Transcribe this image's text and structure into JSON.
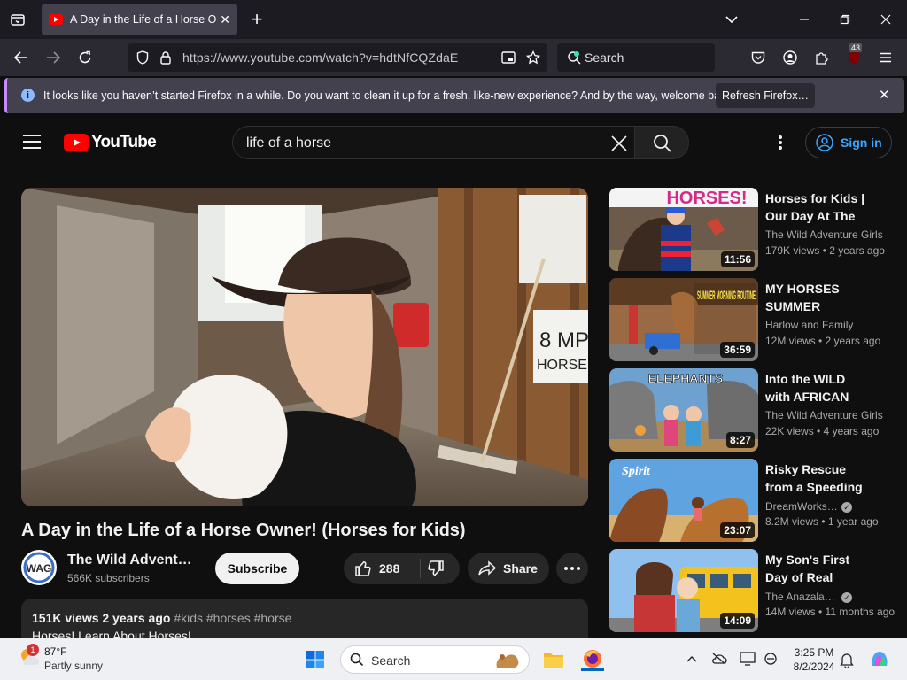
{
  "browser": {
    "tab_title": "A Day in the Life of a Horse Owner! (Horses for Kids) - YouTube",
    "url": "https://www.youtube.com/watch?v=hdtNfCQZdaE",
    "search_placeholder": "Search",
    "extension_badge": "43"
  },
  "notification": {
    "message": "It looks like you haven’t started Firefox in a while. Do you want to clean it up for a fresh, like-new experience? And by the way, welcome back!",
    "refresh_label": "Refresh Firefox…"
  },
  "youtube": {
    "logo_text": "YouTube",
    "search_query": "life of a horse",
    "sign_in_label": "Sign in"
  },
  "video": {
    "title": "A Day in the Life of a Horse Owner! (Horses for Kids)",
    "channel_name": "The Wild Adventure Girls",
    "subscribers": "566K subscribers",
    "avatar_text": "WAG",
    "subscribe_label": "Subscribe",
    "likes": "288",
    "share_label": "Share",
    "views_date": "151K views  2 years ago",
    "hashtags": "#kids #horses #horse",
    "description_line": "Horses! Learn About Horses!"
  },
  "recommendations": [
    {
      "title": "Horses for Kids | Our Day At The Farm",
      "channel": "The Wild Adventure Girls",
      "verified": false,
      "stats": "179K views  • 2 years ago",
      "duration": "11:56",
      "thumb_text": "HORSES!"
    },
    {
      "title": "MY HORSES SUMMER MORNING ROUTINE",
      "channel": "Harlow and Family",
      "verified": false,
      "stats": "12M views  • 2 years ago",
      "duration": "36:59",
      "thumb_text": "SUMMER MORNING ROUTINE"
    },
    {
      "title": "Into the WILD with AFRICAN ANIMALS",
      "channel": "The Wild Adventure Girls",
      "verified": false,
      "stats": "22K views  • 4 years ago",
      "duration": "8:27",
      "thumb_text": "ELEPHANTS"
    },
    {
      "title": "Risky Rescue from a Speeding Train",
      "channel": "DreamWorks Spirit",
      "verified": true,
      "stats": "8.2M views  • 1 year ago",
      "duration": "23:07",
      "thumb_text": "Spirit"
    },
    {
      "title": "My Son's First Day of Real School",
      "channel": "The Anazala Family",
      "verified": true,
      "stats": "14M views  • 11 months ago",
      "duration": "14:09",
      "thumb_text": ""
    }
  ],
  "taskbar": {
    "temperature": "87°F",
    "condition": "Partly sunny",
    "weather_badge": "1",
    "search_label": "Search",
    "time": "3:25 PM",
    "date": "8/2/2024"
  }
}
